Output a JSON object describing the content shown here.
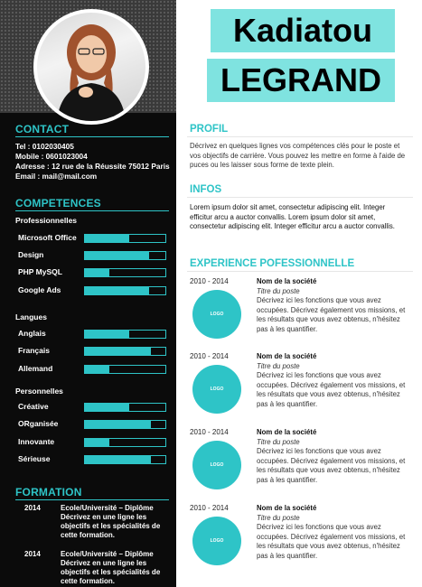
{
  "name": {
    "first": "Kadiatou",
    "last": "LEGRAND"
  },
  "colors": {
    "accent": "#2ec4c7",
    "name_bg": "#7fe3e0",
    "sidebar": "#0b0b0b"
  },
  "contact": {
    "title": "CONTACT",
    "lines": [
      "Tel : 0102030405",
      "Mobile : 0601023004",
      "Adresse : 12 rue de la Réussite 75012 Paris",
      "Email : mail@mail.com"
    ]
  },
  "competences": {
    "title": "COMPETENCES",
    "groups": [
      {
        "label": "Professionnelles",
        "items": [
          {
            "label": "Microsoft Office",
            "level": 0.55
          },
          {
            "label": "Design",
            "level": 0.8
          },
          {
            "label": "PHP MySQL",
            "level": 0.3
          },
          {
            "label": "Google Ads",
            "level": 0.8
          }
        ]
      },
      {
        "label": "Langues",
        "items": [
          {
            "label": "Anglais",
            "level": 0.55
          },
          {
            "label": "Français",
            "level": 0.82
          },
          {
            "label": "Allemand",
            "level": 0.3
          }
        ]
      },
      {
        "label": "Personnelles",
        "items": [
          {
            "label": "Créative",
            "level": 0.55
          },
          {
            "label": "ORganisée",
            "level": 0.82
          },
          {
            "label": "Innovante",
            "level": 0.3
          },
          {
            "label": "Sérieuse",
            "level": 0.82
          }
        ]
      }
    ]
  },
  "formation": {
    "title": "FORMATION",
    "items": [
      {
        "year": "2014",
        "text": "Ecole/Université – Diplôme Décrivez en une ligne les objectifs et les spécialités de cette formation."
      },
      {
        "year": "2014",
        "text": "Ecole/Université – Diplôme Décrivez en une ligne les objectifs et les spécialités de cette formation."
      }
    ]
  },
  "profil": {
    "title": "PROFIL",
    "text": "Décrivez en quelques lignes vos compétences clés pour le poste et vos objectifs de carrière. Vous pouvez les mettre en forme à l'aide de puces ou les laisser sous forme de texte plein."
  },
  "infos": {
    "title": "INFOS",
    "text": "Lorem ipsum dolor sit amet, consectetur adipiscing elit. Integer efficitur arcu a auctor convallis. Lorem ipsum dolor sit amet, consectetur adipiscing elit. Integer efficitur arcu a auctor convallis."
  },
  "experience": {
    "title": "EXPERIENCE POFESSIONNELLE",
    "items": [
      {
        "date": "2010 - 2014",
        "logo": "LOGO",
        "company": "Nom de la société",
        "position": "Titre du poste",
        "description": "Décrivez ici les fonctions que vous avez occupées. Décrivez également vos missions, et les résultats que vous avez obtenus, n'hésitez pas à les quantifier."
      },
      {
        "date": "2010 - 2014",
        "logo": "LOGO",
        "company": "Nom de la société",
        "position": "Titre du poste",
        "description": "Décrivez ici les fonctions que vous avez occupées. Décrivez également vos missions, et les résultats que vous avez obtenus, n'hésitez pas à les quantifier."
      },
      {
        "date": "2010 - 2014",
        "logo": "LOGO",
        "company": "Nom de la société",
        "position": "Titre du poste",
        "description": "Décrivez ici les fonctions que vous avez occupées. Décrivez également vos missions, et les résultats que vous avez obtenus, n'hésitez pas à les quantifier."
      },
      {
        "date": "2010 - 2014",
        "logo": "LOGO",
        "company": "Nom de la société",
        "position": "Titre du poste",
        "description": "Décrivez ici les fonctions que vous avez occupées. Décrivez également vos missions, et les résultats que vous avez obtenus, n'hésitez pas à les quantifier."
      }
    ]
  }
}
